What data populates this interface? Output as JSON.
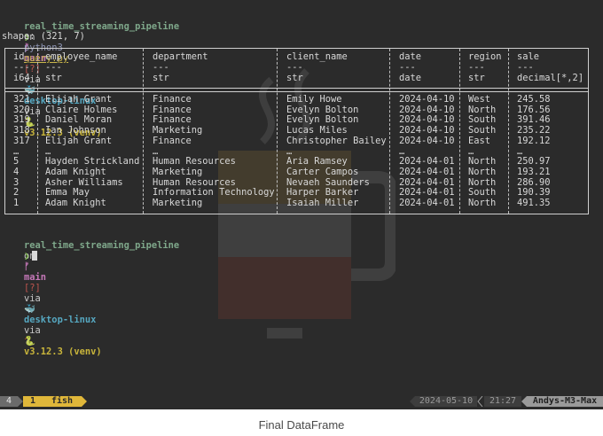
{
  "prompt": {
    "project": "real_time_streaming_pipeline",
    "on": "on",
    "branch_icon": "ᚠ",
    "branch": "main",
    "status": "[?]",
    "via1": "via",
    "host_icon": "🐳",
    "host": "desktop-linux",
    "via2": "via",
    "py_icon": "🐍",
    "version": "v3.12.3 (venv)",
    "symbol": "❯"
  },
  "command": {
    "program": "python3",
    "arg": "query.py"
  },
  "shape_line": "shape: (321, 7)",
  "table": {
    "headers": [
      "id",
      "employee_name",
      "department",
      "client_name",
      "date",
      "region",
      "sale"
    ],
    "dashes": [
      "---",
      "---",
      "---",
      "---",
      "---",
      "---",
      "---"
    ],
    "types": [
      "i64",
      "str",
      "str",
      "str",
      "date",
      "str",
      "decimal[*,2]"
    ],
    "rows": [
      [
        "321",
        "Elijah Grant",
        "Finance",
        "Emily Howe",
        "2024-04-10",
        "West",
        "245.58"
      ],
      [
        "320",
        "Claire Holmes",
        "Finance",
        "Evelyn Bolton",
        "2024-04-10",
        "North",
        "176.56"
      ],
      [
        "319",
        "Daniel Moran",
        "Finance",
        "Evelyn Bolton",
        "2024-04-10",
        "South",
        "391.46"
      ],
      [
        "318",
        "Ian Johnson",
        "Marketing",
        "Lucas Miles",
        "2024-04-10",
        "South",
        "235.22"
      ],
      [
        "317",
        "Elijah Grant",
        "Finance",
        "Christopher Bailey",
        "2024-04-10",
        "East",
        "192.12"
      ],
      [
        "…",
        "…",
        "…",
        "…",
        "…",
        "…",
        "…"
      ],
      [
        "5",
        "Hayden Strickland",
        "Human Resources",
        "Aria Ramsey",
        "2024-04-01",
        "North",
        "250.97"
      ],
      [
        "4",
        "Adam Knight",
        "Marketing",
        "Carter Campos",
        "2024-04-01",
        "North",
        "193.21"
      ],
      [
        "3",
        "Asher Williams",
        "Human Resources",
        "Nevaeh Saunders",
        "2024-04-01",
        "North",
        "286.90"
      ],
      [
        "2",
        "Emma May",
        "Information Technology",
        "Harper Barker",
        "2024-04-01",
        "South",
        "190.39"
      ],
      [
        "1",
        "Adam Knight",
        "Marketing",
        "Isaiah Miller",
        "2024-04-01",
        "North",
        "491.35"
      ]
    ]
  },
  "statusbar": {
    "pane": "4",
    "window_index": "1",
    "window_name": "fish",
    "date": "2024-05-10",
    "time": "21:27",
    "hostname": "Andys-M3-Max"
  },
  "colors": {
    "background": "#2b2b2b",
    "status_accent": "#e0b73a",
    "status_gray": "#6b6b6b"
  },
  "caption": "Final DataFrame"
}
